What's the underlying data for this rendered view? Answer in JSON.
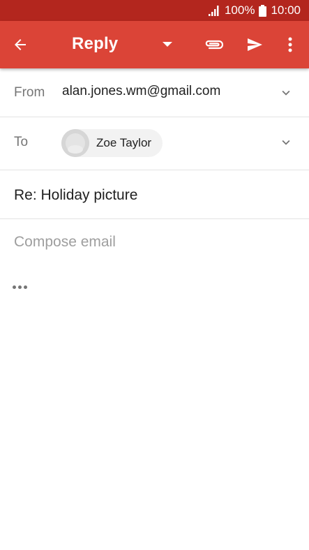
{
  "status_bar": {
    "battery_percent": "100%",
    "time": "10:00",
    "icons": [
      "signal-icon",
      "battery-icon"
    ]
  },
  "toolbar": {
    "title": "Reply",
    "icons": [
      "back-arrow-icon",
      "dropdown-triangle-icon",
      "paperclip-icon",
      "send-icon",
      "more-vert-icon"
    ]
  },
  "compose": {
    "from_label": "From",
    "from_value": "alan.jones.wm@gmail.com",
    "to_label": "To",
    "recipient_name": "Zoe Taylor",
    "subject": "Re: Holiday picture",
    "body_placeholder": "Compose email"
  },
  "colors": {
    "status_bar": "#b3261e",
    "toolbar": "#db4437",
    "text_primary": "#212121",
    "text_secondary": "#757575",
    "placeholder": "#9e9e9e",
    "chip": "#f2f2f2"
  }
}
